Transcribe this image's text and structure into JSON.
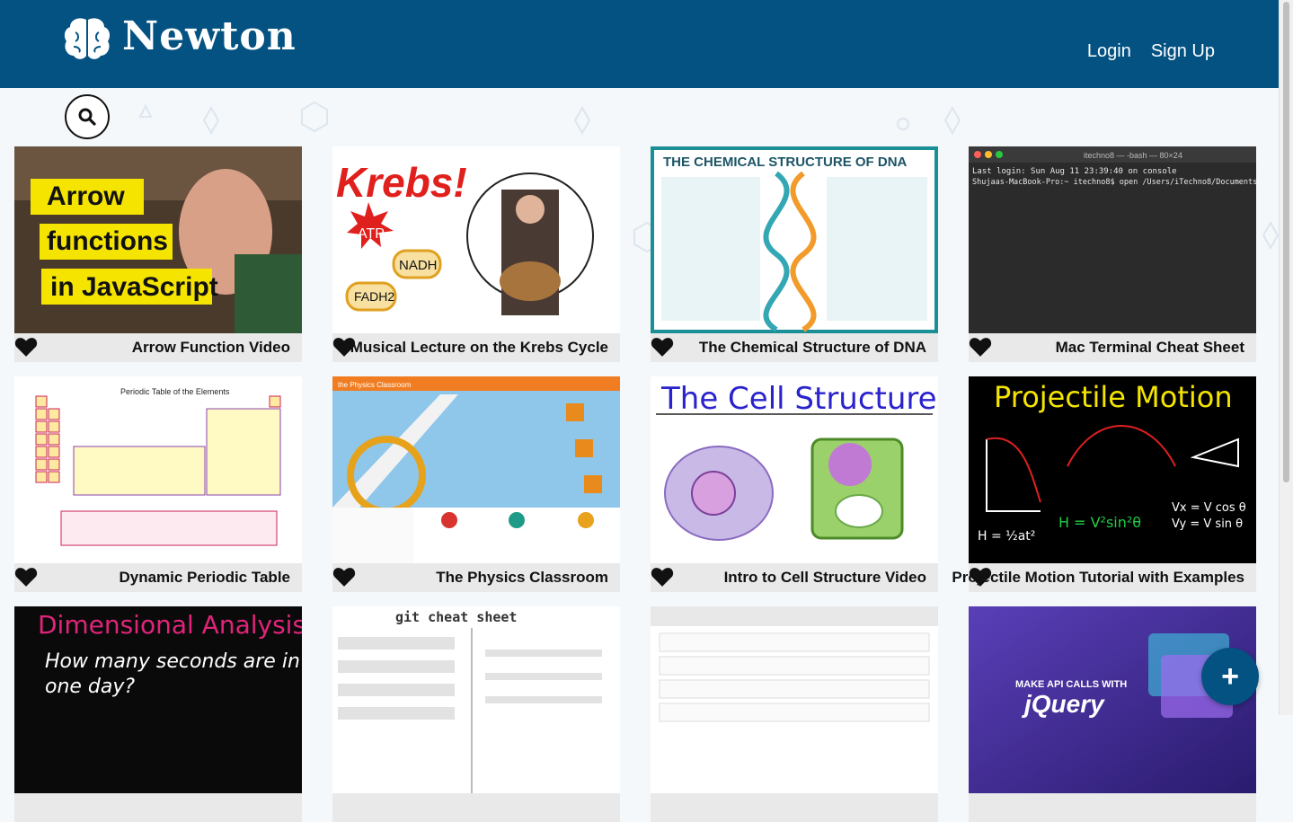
{
  "header": {
    "brand_name": "Newton",
    "login_label": "Login",
    "signup_label": "Sign Up"
  },
  "colors": {
    "primary": "#045282",
    "page_bg": "#f4f8fb",
    "card_footer": "#e9e9e9"
  },
  "search": {
    "icon": "search-icon"
  },
  "cards": [
    {
      "title": "Arrow Function Video",
      "thumb_text": [
        "Arrow",
        "functions",
        "in JavaScript"
      ]
    },
    {
      "title": "Musical Lecture on the Krebs Cycle",
      "thumb_text": [
        "Krebs!",
        "ATP",
        "NADH",
        "FADH2"
      ]
    },
    {
      "title": "The Chemical Structure of DNA",
      "thumb_text": [
        "THE CHEMICAL STRUCTURE OF DNA"
      ]
    },
    {
      "title": "Mac Terminal Cheat Sheet",
      "thumb_text": [
        "itechno8 — -bash — 80×24",
        "Last login: Sun Aug 11 23:39:40 on console",
        "Shujaas-MacBook-Pro:~ itechno8$ open /Users/iTechno8/Documents"
      ]
    },
    {
      "title": "Dynamic Periodic Table",
      "thumb_text": [
        "Periodic Table of the Elements"
      ]
    },
    {
      "title": "The Physics Classroom",
      "thumb_text": [
        "the Physics Classroom"
      ]
    },
    {
      "title": "Intro to Cell Structure Video",
      "thumb_text": [
        "The Cell Structure"
      ]
    },
    {
      "title": "Projectile Motion Tutorial with Examples",
      "thumb_text": [
        "Projectile Motion"
      ]
    },
    {
      "title": "",
      "thumb_text": [
        "Dimensional Analysis",
        "How many seconds are in",
        "one day?"
      ]
    },
    {
      "title": "",
      "thumb_text": [
        "git cheat sheet"
      ]
    },
    {
      "title": "",
      "thumb_text": []
    },
    {
      "title": "",
      "thumb_text": [
        "MAKE API CALLS WITH",
        "jQuery"
      ]
    }
  ],
  "fab": {
    "label": "+"
  }
}
